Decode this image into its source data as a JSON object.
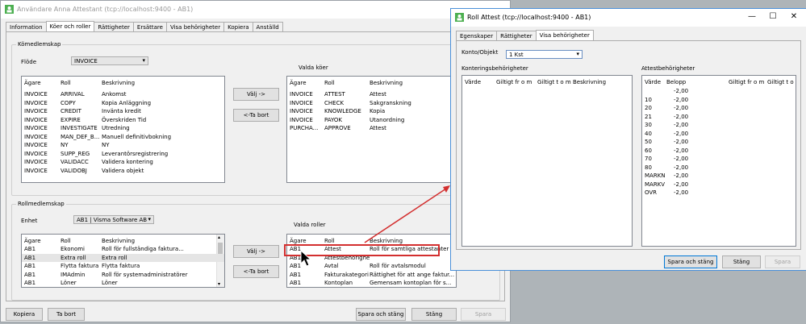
{
  "main": {
    "title": "Användare Anna Attestant (tcp://localhost:9400 - AB1)",
    "tabs": [
      "Information",
      "Köer och roller",
      "Rättigheter",
      "Ersättare",
      "Visa behörigheter",
      "Kopiera",
      "Anställd"
    ],
    "kogroup_label": "Kömedlemskap",
    "flode_label": "Flöde",
    "flode_value": "INVOICE",
    "valda_koer_label": "Valda köer",
    "kolumn": {
      "agare": "Ägare",
      "roll": "Roll",
      "beskrivning": "Beskrivning"
    },
    "available_queues": [
      {
        "agare": "INVOICE",
        "roll": "ARRIVAL",
        "beskrivning": "Ankomst"
      },
      {
        "agare": "INVOICE",
        "roll": "COPY",
        "beskrivning": "Kopia Anläggning"
      },
      {
        "agare": "INVOICE",
        "roll": "CREDIT",
        "beskrivning": "Invänta kredit"
      },
      {
        "agare": "INVOICE",
        "roll": "EXPIRE",
        "beskrivning": "Överskriden Tid"
      },
      {
        "agare": "INVOICE",
        "roll": "INVESTIGATE",
        "beskrivning": "Utredning"
      },
      {
        "agare": "INVOICE",
        "roll": "MAN_DEF_B...",
        "beskrivning": "Manuell definitivbokning"
      },
      {
        "agare": "INVOICE",
        "roll": "NY",
        "beskrivning": "NY"
      },
      {
        "agare": "INVOICE",
        "roll": "SUPP_REG",
        "beskrivning": "Leverantörsregistrering"
      },
      {
        "agare": "INVOICE",
        "roll": "VALIDACC",
        "beskrivning": "Validera kontering"
      },
      {
        "agare": "INVOICE",
        "roll": "VALIDOBJ",
        "beskrivning": "Validera objekt"
      }
    ],
    "selected_queues": [
      {
        "agare": "INVOICE",
        "roll": "ATTEST",
        "beskrivning": "Attest"
      },
      {
        "agare": "INVOICE",
        "roll": "CHECK",
        "beskrivning": "Sakgranskning"
      },
      {
        "agare": "INVOICE",
        "roll": "KNOWLEDGE",
        "beskrivning": "Kopia"
      },
      {
        "agare": "INVOICE",
        "roll": "PAYOK",
        "beskrivning": "Utanordning"
      },
      {
        "agare": "PURCHA...",
        "roll": "APPROVE",
        "beskrivning": "Attest"
      }
    ],
    "valj_label": "Välj ->",
    "tabort_label": "<-Ta bort",
    "rollgroup_label": "Rollmedlemskap",
    "enhet_label": "Enhet",
    "enhet_value": "AB1 | Visma Software AB",
    "valda_roller_label": "Valda roller",
    "available_roles": [
      {
        "agare": "AB1",
        "roll": "Ekonomi",
        "beskrivning": "Roll för fullständiga faktura..."
      },
      {
        "agare": "AB1",
        "roll": "Extra roll",
        "beskrivning": "Extra roll"
      },
      {
        "agare": "AB1",
        "roll": "Flytta faktura",
        "beskrivning": "Flytta faktura"
      },
      {
        "agare": "AB1",
        "roll": "IMAdmin",
        "beskrivning": "Roll för systemadministratörer"
      },
      {
        "agare": "AB1",
        "roll": "Löner",
        "beskrivning": "Löner"
      }
    ],
    "selected_roles": [
      {
        "agare": "AB1",
        "roll": "Attest",
        "beskrivning": "Roll för samtliga attestanter"
      },
      {
        "agare": "AB1",
        "roll": "Attestbehörighet ...",
        "beskrivning": ""
      },
      {
        "agare": "AB1",
        "roll": "Avtal",
        "beskrivning": "Roll för avtalsmodul"
      },
      {
        "agare": "AB1",
        "roll": "Fakturakategori",
        "beskrivning": "Rättighet för att ange faktur..."
      },
      {
        "agare": "AB1",
        "roll": "Kontoplan",
        "beskrivning": "Gemensam kontoplan för s..."
      }
    ],
    "footer": {
      "kopiera": "Kopiera",
      "tabort": "Ta bort",
      "spara_stang": "Spara och stäng",
      "stang": "Stäng",
      "spara": "Spara"
    }
  },
  "dialog": {
    "title": "Roll Attest (tcp://localhost:9400 - AB1)",
    "tabs": [
      "Egenskaper",
      "Rättigheter",
      "Visa behörigheter"
    ],
    "konto_label": "Konto/Objekt",
    "konto_value": "1 Kst",
    "kontering_label": "Konteringsbehörigheter",
    "attest_label": "Attestbehörigheter",
    "kontering_cols": [
      "Värde",
      "Giltigt fr o m",
      "Giltigt t o m",
      "Beskrivning"
    ],
    "attest_cols": [
      "Värde",
      "Belopp",
      "Giltigt fr o m",
      "Giltigt t o m"
    ],
    "attest_rows": [
      {
        "varde": "",
        "belopp": "-2,00"
      },
      {
        "varde": "10",
        "belopp": "-2,00"
      },
      {
        "varde": "20",
        "belopp": "-2,00"
      },
      {
        "varde": "21",
        "belopp": "-2,00"
      },
      {
        "varde": "30",
        "belopp": "-2,00"
      },
      {
        "varde": "40",
        "belopp": "-2,00"
      },
      {
        "varde": "50",
        "belopp": "-2,00"
      },
      {
        "varde": "60",
        "belopp": "-2,00"
      },
      {
        "varde": "70",
        "belopp": "-2,00"
      },
      {
        "varde": "80",
        "belopp": "-2,00"
      },
      {
        "varde": "MARKN",
        "belopp": "-2,00"
      },
      {
        "varde": "MARKV",
        "belopp": "-2,00"
      },
      {
        "varde": "OVR",
        "belopp": "-2,00"
      }
    ],
    "footer": {
      "spara_stang": "Spara och stäng",
      "stang": "Stäng",
      "spara": "Spara"
    }
  }
}
